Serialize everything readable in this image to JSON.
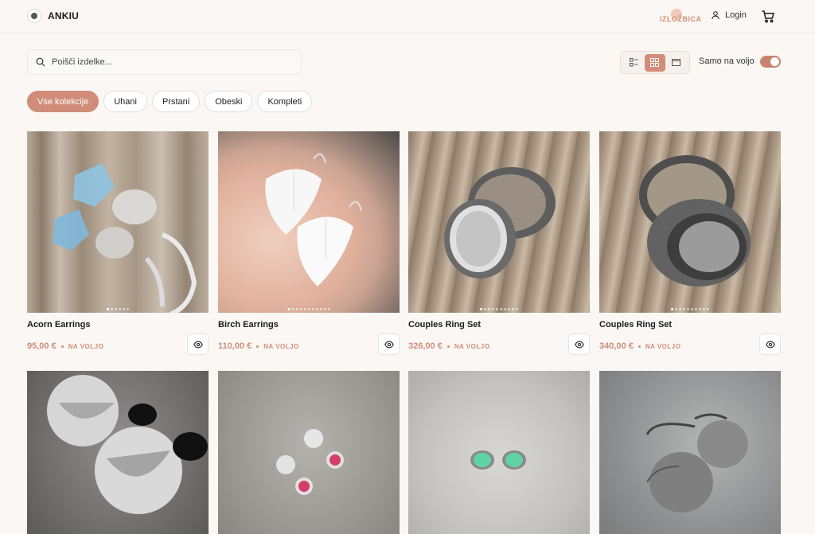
{
  "header": {
    "brand": "ANKIU",
    "partner_logo": "IZLOŽBICA",
    "login_label": "Login",
    "icons": {
      "logo": "brand-logo-icon",
      "user": "user-icon",
      "cart": "cart-icon"
    }
  },
  "toolbar": {
    "search_placeholder": "Poišči izdelke...",
    "view_modes": [
      "list-view",
      "grid-view",
      "single-view"
    ],
    "active_view": "grid-view",
    "availability_label": "Samo na voljo",
    "availability_on": true
  },
  "filters": [
    {
      "label": "Vse kolekcije",
      "active": true
    },
    {
      "label": "Uhani",
      "active": false
    },
    {
      "label": "Prstani",
      "active": false
    },
    {
      "label": "Obeski",
      "active": false
    },
    {
      "label": "Kompleti",
      "active": false
    }
  ],
  "products": [
    {
      "title": "Acorn Earrings",
      "price": "95,00 €",
      "badge": "NA VOLJO"
    },
    {
      "title": "Birch Earrings",
      "price": "110,00 €",
      "badge": "NA VOLJO"
    },
    {
      "title": "Couples Ring Set",
      "price": "326,00 €",
      "badge": "NA VOLJO"
    },
    {
      "title": "Couples Ring Set",
      "price": "340,00 €",
      "badge": "NA VOLJO"
    },
    {
      "title": "",
      "price": "",
      "badge": ""
    },
    {
      "title": "",
      "price": "",
      "badge": ""
    },
    {
      "title": "",
      "price": "",
      "badge": ""
    },
    {
      "title": "",
      "price": "",
      "badge": ""
    }
  ],
  "colors": {
    "accent": "#d18d79",
    "price": "#cf8f78",
    "background": "#faf7f4"
  }
}
